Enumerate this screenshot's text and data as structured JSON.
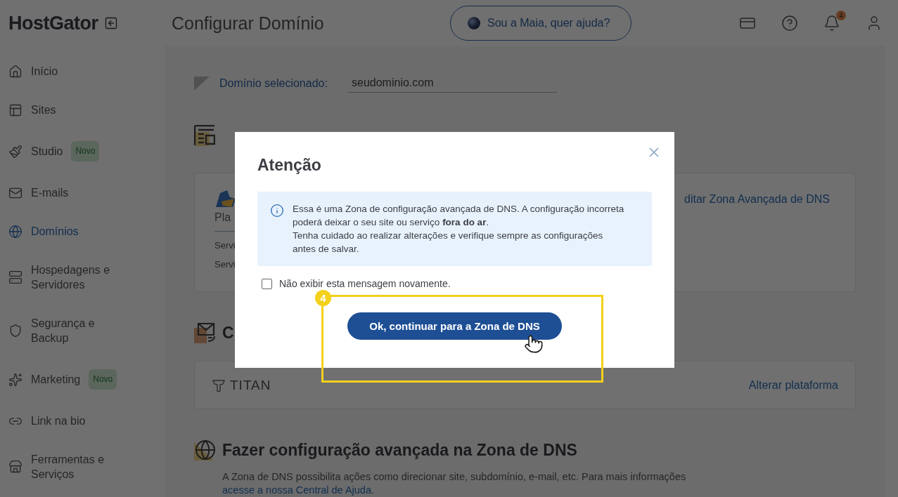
{
  "header": {
    "logo": "HostGator",
    "page_title": "Configurar Domínio",
    "assistant_button": "Sou a Maia, quer ajuda?",
    "notification_count": "4"
  },
  "sidebar": {
    "items": [
      {
        "label": "Início",
        "kind": "home",
        "selected": false
      },
      {
        "label": "Sites",
        "kind": "sites",
        "selected": false
      },
      {
        "label": "Studio",
        "kind": "studio",
        "selected": false,
        "badge": "Novo"
      },
      {
        "label": "E-mails",
        "kind": "mail",
        "selected": false
      },
      {
        "label": "Domínios",
        "kind": "globe",
        "selected": true
      },
      {
        "label": "Hospedagens e Servidores",
        "kind": "server",
        "selected": false
      },
      {
        "label": "Segurança e Backup",
        "kind": "shield",
        "selected": false
      },
      {
        "label": "Marketing",
        "kind": "marketing",
        "selected": false,
        "badge": "Novo"
      },
      {
        "label": "Link na bio",
        "kind": "link",
        "selected": false
      },
      {
        "label": "Ferramentas e Serviços",
        "kind": "store",
        "selected": false
      }
    ]
  },
  "domain_selector": {
    "label": "Domínio selecionado:",
    "value": "seudominio.com"
  },
  "site_platform": {
    "card_title": "Pla",
    "rows": [
      "Servi",
      "Servi"
    ],
    "link": "ditar Zona Avançada de DNS"
  },
  "email_platform": {
    "heading": "C",
    "provider": "TITAN",
    "link": "Alterar plataforma"
  },
  "dns_section": {
    "heading": "Fazer configuração avançada na Zona de DNS",
    "text": "A Zona de DNS possibilita ações como direcionar site, subdomínio, e-mail, etc. Para mais informações",
    "link": "acesse a nossa Central de Ajuda",
    "trailing": "."
  },
  "modal": {
    "title": "Atenção",
    "message": [
      "Essa é uma Zona de configuração avançada de DNS. A configuração incorreta poderá deixar o seu site ou serviço **fora do ar**.",
      "Tenha cuidado ao realizar alterações e verifique sempre as configurações antes de salvar."
    ],
    "checkbox": {
      "label": "Não exibir esta mensagem novamente.",
      "checked": false
    },
    "primary_button": "Ok, continuar para a Zona de DNS"
  },
  "tutorial_step": {
    "number": "4"
  }
}
